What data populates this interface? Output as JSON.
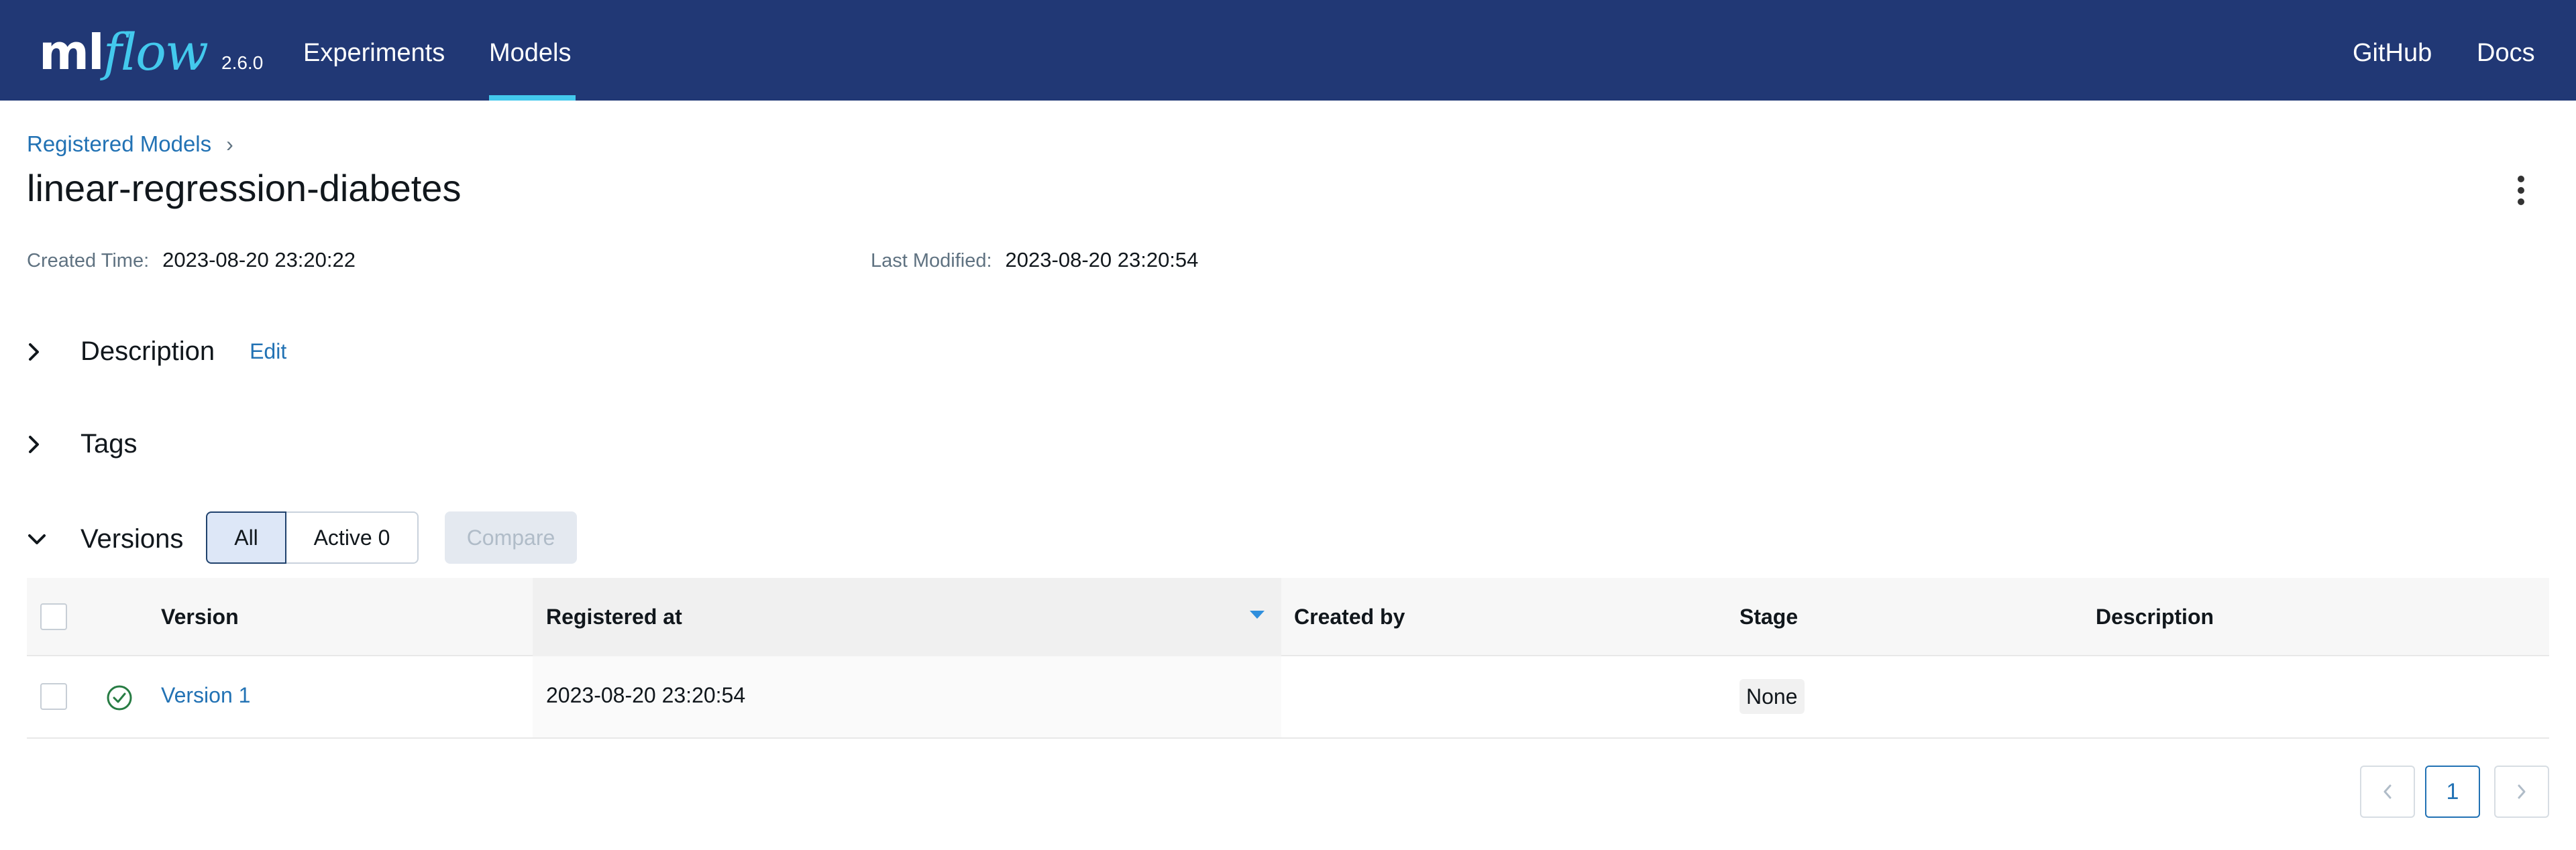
{
  "header": {
    "logo_ml": "ml",
    "logo_flow": "flow",
    "version": "2.6.0",
    "nav": [
      {
        "label": "Experiments"
      },
      {
        "label": "Models"
      }
    ],
    "active_nav": "Models",
    "right_links": [
      {
        "label": "GitHub"
      },
      {
        "label": "Docs"
      }
    ]
  },
  "breadcrumb": {
    "parent": "Registered Models",
    "separator": "›"
  },
  "model": {
    "name": "linear-regression-diabetes",
    "created_label": "Created Time:",
    "created_value": "2023-08-20 23:20:22",
    "modified_label": "Last Modified:",
    "modified_value": "2023-08-20 23:20:54"
  },
  "sections": {
    "description": {
      "title": "Description",
      "edit": "Edit",
      "expanded": false
    },
    "tags": {
      "title": "Tags",
      "expanded": false
    },
    "versions": {
      "title": "Versions",
      "expanded": true
    }
  },
  "versions_filter": {
    "all_label": "All",
    "active_label": "Active 0",
    "selected": "All",
    "compare_label": "Compare",
    "compare_disabled": true
  },
  "table": {
    "columns": [
      "Version",
      "Registered at",
      "Created by",
      "Stage",
      "Description"
    ],
    "sorted_column": "Registered at",
    "sort_direction": "descending",
    "rows": [
      {
        "status": "ready",
        "version": "Version 1",
        "registered_at": "2023-08-20 23:20:54",
        "created_by": "",
        "stage": "None",
        "description": ""
      }
    ]
  },
  "pagination": {
    "current_page": "1",
    "prev_icon": "chevron-left-icon",
    "next_icon": "chevron-right-icon"
  },
  "colors": {
    "header_bg": "#213875",
    "accent": "#43c9ed",
    "link": "#2272b4",
    "status_ok": "#277c43"
  }
}
